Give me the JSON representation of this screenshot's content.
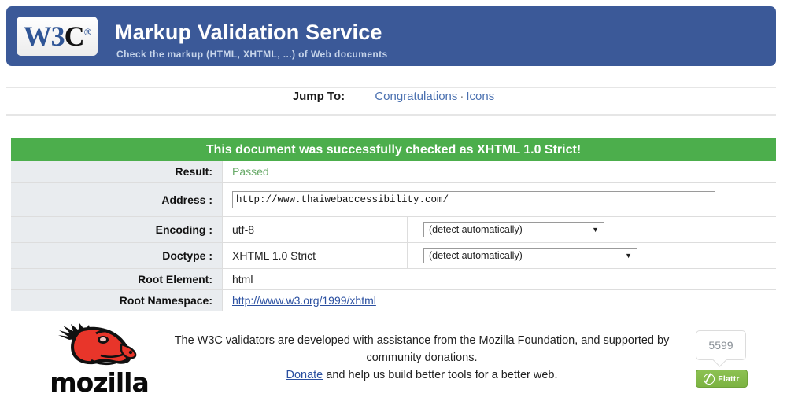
{
  "header": {
    "logo_w3": "W3",
    "logo_c": "C",
    "logo_reg": "®",
    "title": "Markup Validation Service",
    "subtitle": "Check the markup (HTML, XHTML, ...) of Web documents",
    "bar_color": "#3b5998"
  },
  "jump_to": {
    "label": "Jump To:",
    "links": [
      {
        "label": "Congratulations"
      },
      {
        "label": "Icons"
      }
    ],
    "separator": "·",
    "link_color": "#4a70b0"
  },
  "banner": {
    "message": "This document was successfully checked as XHTML 1.0 Strict!",
    "color": "#4cae4c"
  },
  "results": {
    "rows": [
      {
        "label": "Result:",
        "value": "Passed"
      },
      {
        "label": "Address :",
        "value": ""
      },
      {
        "label": "Encoding :",
        "value": "utf-8"
      },
      {
        "label": "Doctype :",
        "value": "XHTML 1.0 Strict"
      },
      {
        "label": "Root Element:",
        "value": "html"
      },
      {
        "label": "Root Namespace:",
        "value": "http://www.w3.org/1999/xhtml"
      }
    ],
    "result_status": "Passed",
    "result_color": "#6aab6a",
    "address_value": "http://www.thaiwebaccessibility.com/",
    "encoding_value": "utf-8",
    "encoding_select": "(detect automatically)",
    "doctype_value": "XHTML 1.0 Strict",
    "doctype_select": "(detect automatically)",
    "root_element": "html",
    "root_namespace": "http://www.w3.org/1999/xhtml"
  },
  "footer": {
    "mozilla_wordmark": "mozilla",
    "line1": "The W3C validators are developed with assistance from the Mozilla Foundation, and supported by community donations.",
    "donate_label": "Donate",
    "line2_rest": " and help us build better tools for a better web.",
    "flattr_count": "5599",
    "flattr_label": "Flattr",
    "flattr_color": "#8cc152"
  }
}
